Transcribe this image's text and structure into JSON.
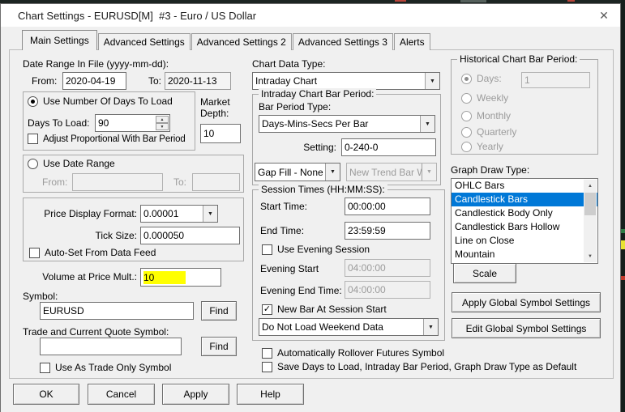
{
  "window": {
    "title": "Chart Settings - EURUSD[M]  #3 - Euro / US Dollar"
  },
  "icons": {
    "close": "✕",
    "combo_arrow": "▼",
    "spinner_up": "▲",
    "spinner_down": "▼",
    "scroll_up": "▲",
    "scroll_down": "▼",
    "check": "✓"
  },
  "colors": {
    "selection_blue": "#0078d7",
    "highlight_yellow": "#ffff00",
    "dialog_bg": "#f0f0f0",
    "titlebar_bg": "#ffffff",
    "backdrop_dark": "#1c2522"
  },
  "tabs": [
    {
      "label": "Main Settings",
      "active": true
    },
    {
      "label": "Advanced Settings",
      "active": false
    },
    {
      "label": "Advanced Settings 2",
      "active": false
    },
    {
      "label": "Advanced Settings 3",
      "active": false
    },
    {
      "label": "Alerts",
      "active": false
    }
  ],
  "left": {
    "date_range_in_file_label": "Date Range In File (yyyy-mm-dd):",
    "from_label": "From:",
    "from_value": "2020-04-19",
    "to_label": "To:",
    "to_value": "2020-11-13",
    "use_num_days_label": "Use Number Of Days To Load",
    "days_to_load_label": "Days To Load:",
    "days_to_load_value": "90",
    "adjust_proportional_label": "Adjust Proportional With Bar Period",
    "market_depth_label": "Market Depth:",
    "market_depth_value": "10",
    "use_date_range_label": "Use Date Range",
    "udr_from_label": "From:",
    "udr_from_value": "",
    "udr_to_label": "To:",
    "udr_to_value": "",
    "price_display_format_label": "Price Display Format:",
    "price_display_format_value": "0.00001",
    "tick_size_label": "Tick Size:",
    "tick_size_value": "0.000050",
    "auto_set_label": "Auto-Set From Data Feed",
    "volume_mult_label": "Volume at Price Mult.:",
    "volume_mult_value": "10",
    "symbol_label": "Symbol:",
    "symbol_value": "EURUSD",
    "find_label": "Find",
    "trade_symbol_label": "Trade and Current Quote Symbol:",
    "trade_symbol_value": "",
    "find2_label": "Find",
    "use_trade_only_label": "Use As Trade Only Symbol"
  },
  "middle": {
    "chart_data_type_label": "Chart Data Type:",
    "chart_data_type_value": "Intraday Chart",
    "intraday_group_title": "Intraday Chart Bar Period:",
    "bar_period_type_label": "Bar Period Type:",
    "bar_period_type_value": "Days-Mins-Secs Per Bar",
    "setting_label": "Setting:",
    "setting_value": "0-240-0",
    "gap_fill_value": "Gap Fill - None",
    "new_trend_value": "New Trend Bar W",
    "session_group_title": "Session Times (HH:MM:SS):",
    "start_time_label": "Start Time:",
    "start_time_value": "00:00:00",
    "end_time_label": "End Time:",
    "end_time_value": "23:59:59",
    "use_evening_label": "Use Evening Session",
    "evening_start_label": "Evening Start",
    "evening_start_value": "04:00:00",
    "evening_end_label": "Evening End Time:",
    "evening_end_value": "04:00:00",
    "new_bar_label": "New Bar At Session Start",
    "weekend_value": "Do Not Load Weekend Data",
    "rollover_label": "Automatically Rollover Futures Symbol",
    "save_defaults_label": "Save Days to Load, Intraday Bar Period, Graph Draw Type as Default"
  },
  "right": {
    "historical_group_title": "Historical Chart Bar Period:",
    "days_label": "Days:",
    "days_value": "1",
    "weekly_label": "Weekly",
    "monthly_label": "Monthly",
    "quarterly_label": "Quarterly",
    "yearly_label": "Yearly",
    "graph_draw_type_label": "Graph Draw Type:",
    "graph_items": [
      "OHLC Bars",
      "Candlestick Bars",
      "Candlestick Body Only",
      "Candlestick Bars Hollow",
      "Line on Close",
      "Mountain"
    ],
    "selected_graph_item": "Candlestick Bars",
    "scale_label": "Scale",
    "apply_global_label": "Apply Global Symbol Settings",
    "edit_global_label": "Edit Global Symbol Settings"
  },
  "footer": {
    "ok": "OK",
    "cancel": "Cancel",
    "apply": "Apply",
    "help": "Help"
  }
}
